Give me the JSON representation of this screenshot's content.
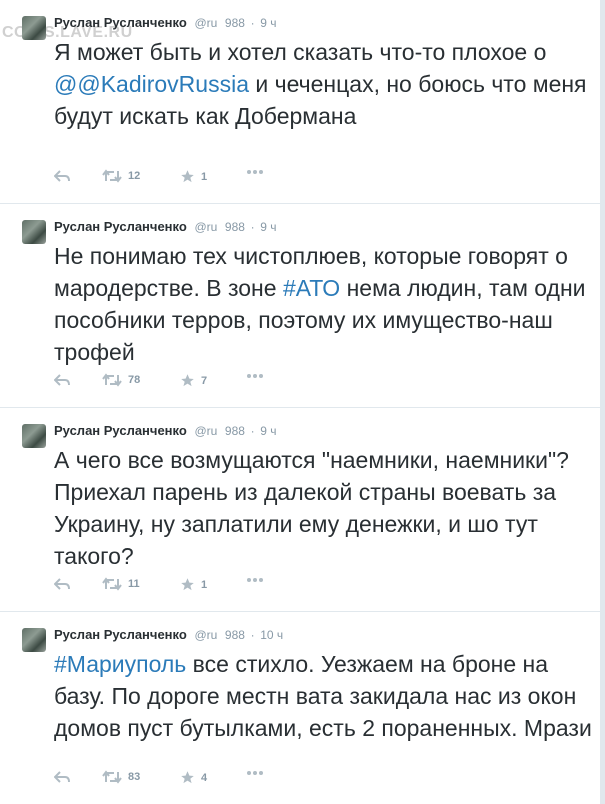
{
  "watermark": "COINS.LAVE.RU",
  "colors": {
    "link": "#2b7bb9",
    "text": "#292f33",
    "meta": "#8899a6",
    "icon": "#b0bcc4",
    "border": "#e1e8ed"
  },
  "tweets": [
    {
      "author": "Руслан Русланченко",
      "handle": "@ru",
      "views": "988",
      "time": "9 ч",
      "parts": [
        {
          "text": "Я  может быть и хотел сказать что-то плохое о "
        },
        {
          "text": "@@KadirovRussia",
          "link": true
        },
        {
          "text": " и чеченцах, но боюсь что меня будут искать как Добермана"
        }
      ],
      "retweets": "12",
      "favorites": "1"
    },
    {
      "author": "Руслан Русланченко",
      "handle": "@ru",
      "views": "988",
      "time": "9 ч",
      "parts": [
        {
          "text": "Не понимаю тех чистоплюев, которые говорят о мародерстве. В зоне "
        },
        {
          "text": "#АТО",
          "link": true
        },
        {
          "text": " нема людин, там одни пособники терров, поэтому их имущество-наш трофей"
        }
      ],
      "retweets": "78",
      "favorites": "7"
    },
    {
      "author": "Руслан Русланченко",
      "handle": "@ru",
      "views": "988",
      "time": "9 ч",
      "parts": [
        {
          "text": "А чего все возмущаются \"наемники, наемники\"? Приехал парень из далекой страны воевать за Украину, ну заплатили ему денежки, и шо тут такого?"
        }
      ],
      "retweets": "11",
      "favorites": "1"
    },
    {
      "author": "Руслан Русланченко",
      "handle": "@ru",
      "views": "988",
      "time": "10 ч",
      "parts": [
        {
          "text": "#Мариуполь",
          "link": true
        },
        {
          "text": " все стихло. Уезжаем на броне на базу. По дороге местн вата закидала нас из окон домов  пуст бутылками, есть 2 пораненных. Мрази"
        }
      ],
      "retweets": "83",
      "favorites": "4"
    }
  ]
}
